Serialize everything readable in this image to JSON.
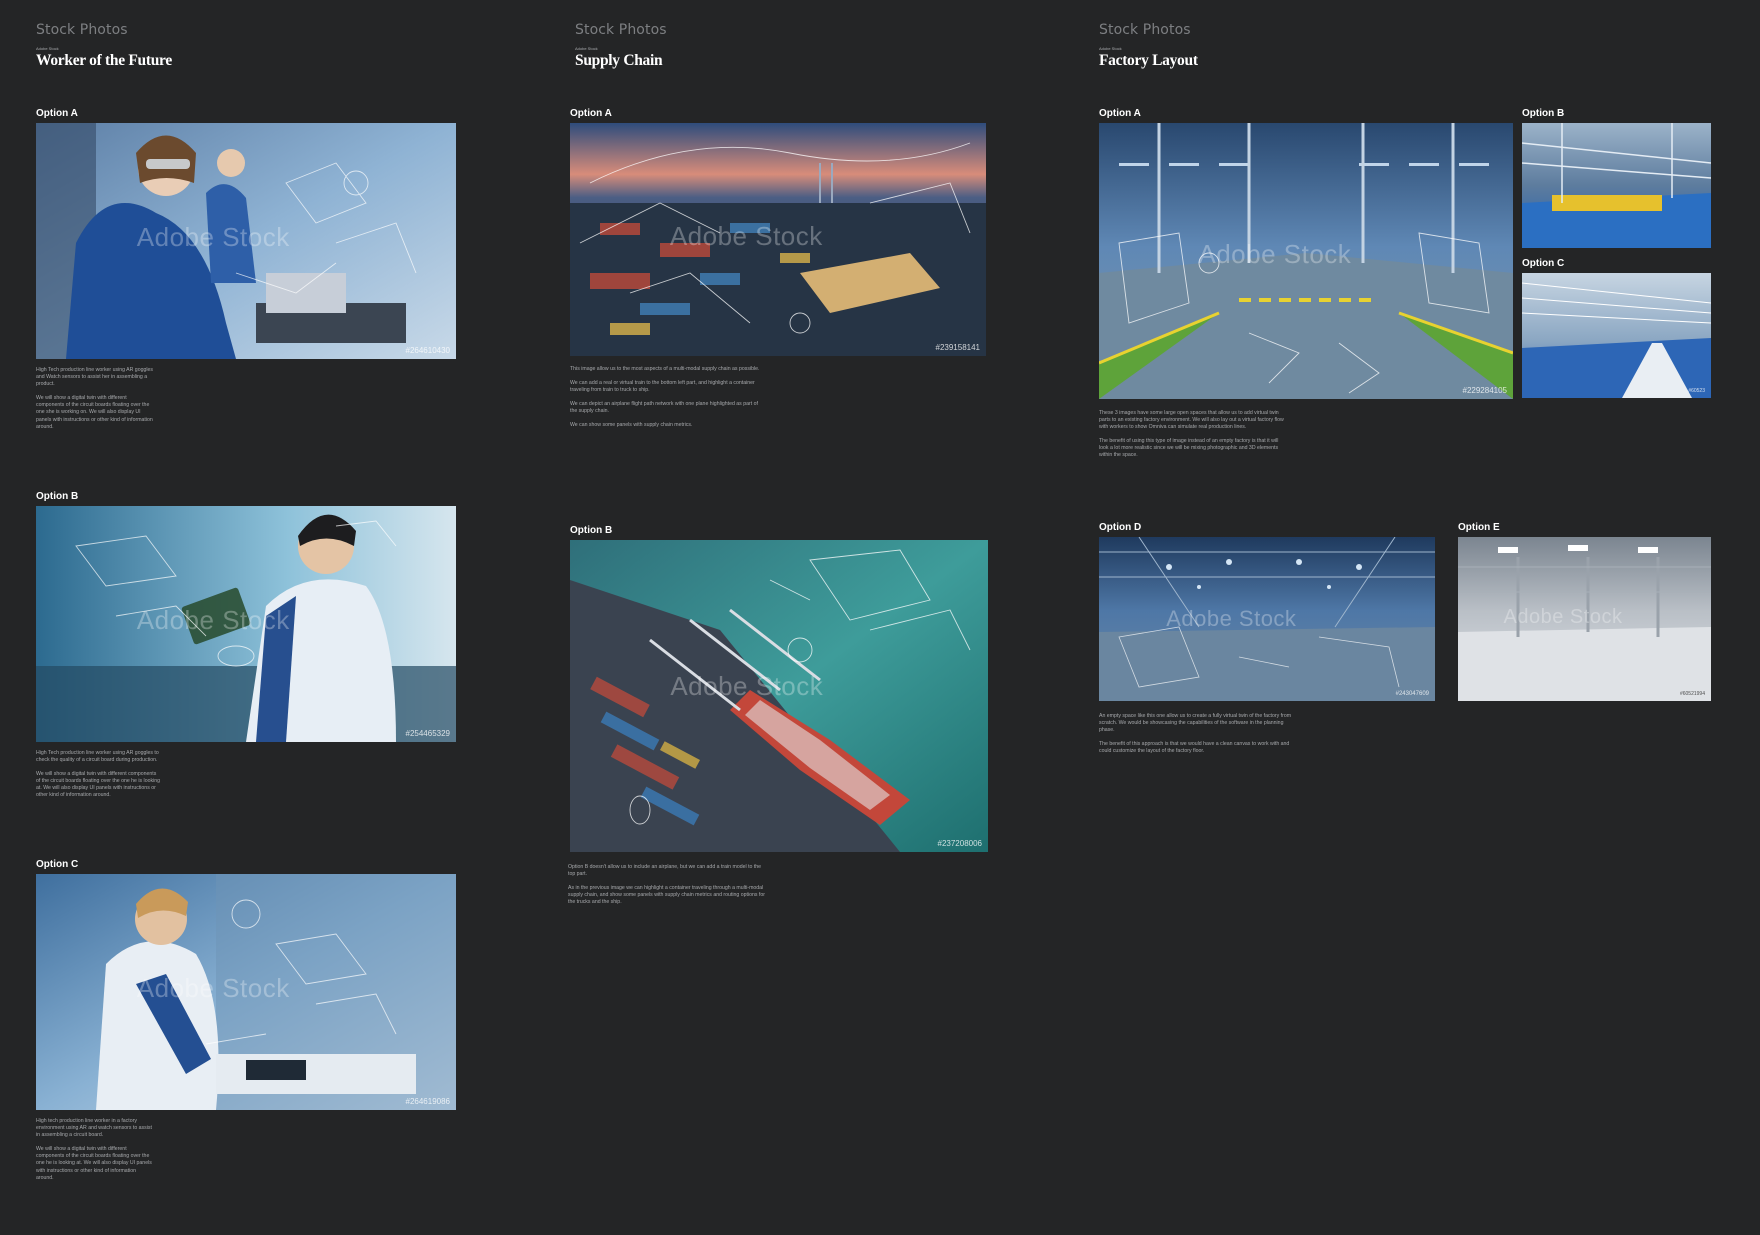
{
  "sections": {
    "worker": {
      "eyebrow": "Stock Photos",
      "kicker": "Adobe Stock",
      "title": "Worker of the Future",
      "options": [
        {
          "label": "Option A",
          "id": "#264610430",
          "watermark": "Adobe Stock",
          "desc": [
            "High Tech production line worker using AR goggles and Watch sensors to assist her in assembling a product.",
            "We will show a digital twin with different components of the circuit boards floating over the one she is working on. We will also display UI panels with instructions or other kind of information around."
          ]
        },
        {
          "label": "Option B",
          "id": "#254465329",
          "watermark": "Adobe Stock",
          "desc": [
            "High Tech production line worker using AR goggles to check the quality of a circuit board during production.",
            "We will show a digital twin with different components of the circuit boards floating over the one he is looking at. We will also display UI panels with instructions or other kind of information around."
          ]
        },
        {
          "label": "Option C",
          "id": "#264619086",
          "watermark": "Adobe Stock",
          "desc": [
            "High tech production line worker in a factory environment using AR and watch sensors to assist in assembling a circuit board.",
            "We will show a digital twin with different components of the circuit boards floating over the one he is looking at. We will also display UI panels with instructions or other kind of information around."
          ]
        }
      ]
    },
    "supply": {
      "eyebrow": "Stock Photos",
      "kicker": "Adobe Stock",
      "title": "Supply Chain",
      "options": [
        {
          "label": "Option A",
          "id": "#239158141",
          "watermark": "Adobe Stock",
          "desc": [
            "This image allow us to the most aspects of a multi-modal supply chain as possible.",
            "We can add a real or virtual train to the bottom left part, and highlight a container traveling from train to truck to ship.",
            "We can depict an airplane flight path network with one plane highlighted as part of the supply chain.",
            "We can show some panels with supply chain metrics."
          ]
        },
        {
          "label": "Option B",
          "id": "#237208006",
          "watermark": "Adobe Stock",
          "desc": [
            "Option B doesn't allow us to include an airplane, but we can add a train model to the top part.",
            "As in the previous image we can highlight a container traveling through a multi-modal supply chain, and show some panels with supply chain metrics and routing options for the trucks and the ship."
          ]
        }
      ]
    },
    "factory": {
      "eyebrow": "Stock Photos",
      "kicker": "Adobe Stock",
      "title": "Factory Layout",
      "options": [
        {
          "label": "Option A",
          "id": "#229284105",
          "watermark": "Adobe Stock"
        },
        {
          "label": "Option B",
          "id": "",
          "watermark": ""
        },
        {
          "label": "Option C",
          "id": "#60523",
          "watermark": ""
        },
        {
          "label": "Option D",
          "id": "#243047609",
          "watermark": "Adobe Stock"
        },
        {
          "label": "Option E",
          "id": "#60521994",
          "watermark": "Adobe Stock"
        }
      ],
      "desc_top": [
        "These 3 images have some large open spaces that allow us to add virtual twin parts to an existing factory environment. We will also lay out a virtual factory flow with workers to show Omniva can simulate real production lines.",
        "The benefit of using this type of image instead of an empty factory is that it will look a lot more realistic since we will be mixing photographic and 3D elements within the space."
      ],
      "desc_bottom": [
        "An empty space like this one allow us to create a fully virtual twin of the factory from scratch. We would be showcasing the capabilities of the software in the planning phase.",
        "The benefit of this approach is that we would have a clean canvas to work with and could customize the layout of the factory floor."
      ]
    }
  },
  "colors": {
    "background": "#242526",
    "eyebrow": "#7d7f82",
    "body_text": "#a7a9ac",
    "photo_blue": "#2f6fb5",
    "safety_yellow": "#e8d230"
  }
}
